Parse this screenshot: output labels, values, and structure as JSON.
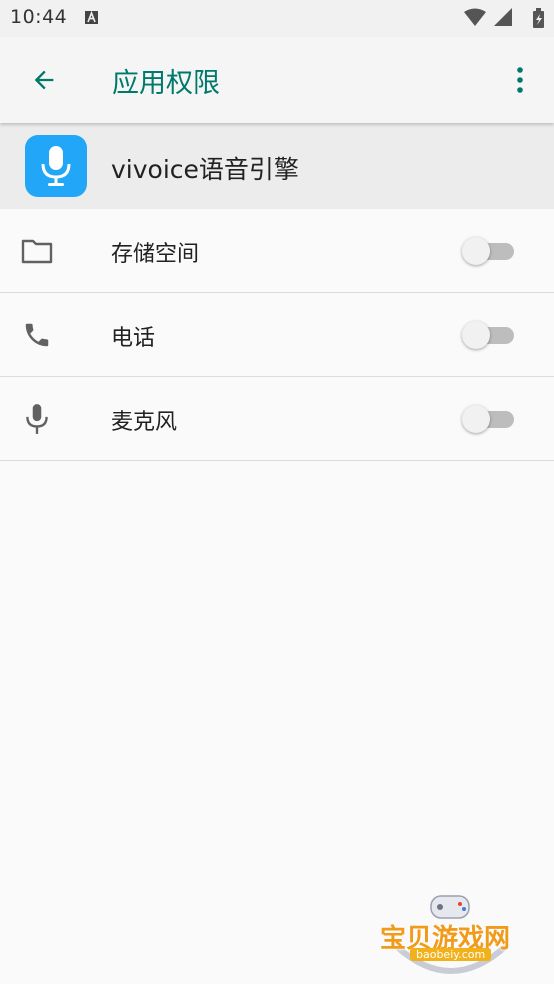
{
  "status_bar": {
    "time": "10:44"
  },
  "toolbar": {
    "title": "应用权限"
  },
  "app": {
    "name": "vivoice语音引擎",
    "icon_color": "#22a6f7"
  },
  "permissions": [
    {
      "label": "存储空间",
      "icon": "folder-icon",
      "enabled": false
    },
    {
      "label": "电话",
      "icon": "phone-icon",
      "enabled": false
    },
    {
      "label": "麦克风",
      "icon": "microphone-icon",
      "enabled": false
    }
  ],
  "watermark": {
    "text": "宝贝游戏网",
    "sub": "baobeiy.com"
  },
  "colors": {
    "accent": "#00796b",
    "text": "#212121",
    "icon": "#616161"
  }
}
